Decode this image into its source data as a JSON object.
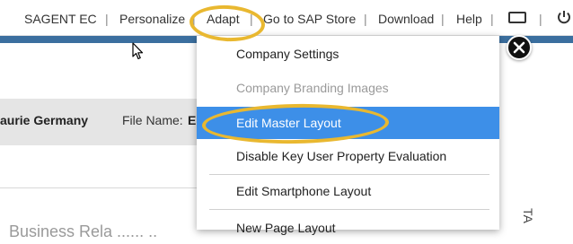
{
  "topnav": {
    "items": [
      "SAGENT EC",
      "Personalize",
      "Adapt",
      "Go to SAP Store",
      "Download",
      "Help"
    ],
    "separator": "|"
  },
  "icons": {
    "window": "window-icon",
    "power": "power-icon",
    "close": "close-icon",
    "cursor": "cursor-arrow-icon"
  },
  "page": {
    "employee_name": "aurie Germany",
    "file_name_label": "File Name:",
    "file_name_value": "E",
    "bottom_text": "Business Rela ...... ..",
    "side_text": "TA"
  },
  "menu": {
    "items": [
      {
        "label": "Company Settings",
        "state": "normal"
      },
      {
        "label": "Company Branding Images",
        "state": "disabled"
      },
      {
        "label": "Edit Master Layout",
        "state": "active"
      },
      {
        "label": "Disable Key User Property Evaluation",
        "state": "normal"
      },
      {
        "label": "Edit Smartphone Layout",
        "state": "normal"
      },
      {
        "label": "New Page Layout",
        "state": "normal"
      }
    ]
  },
  "colors": {
    "highlight": "#3d8fe8",
    "annotation": "#e9b830",
    "header_strip": "#3b6f9f"
  }
}
